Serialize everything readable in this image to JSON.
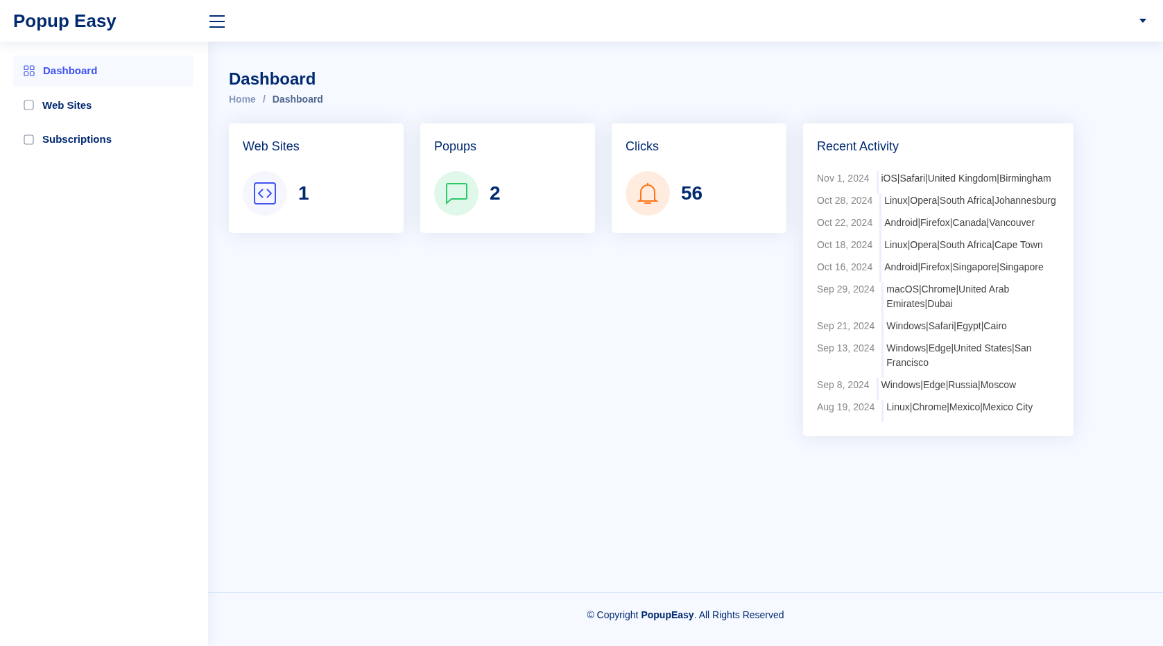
{
  "header": {
    "logo": "Popup Easy"
  },
  "sidebar": {
    "items": [
      {
        "label": "Dashboard",
        "kind": "grid",
        "selected": true
      },
      {
        "label": "Web Sites",
        "kind": "square",
        "selected": false
      },
      {
        "label": "Subscriptions",
        "kind": "square",
        "selected": false
      }
    ]
  },
  "page": {
    "title": "Dashboard",
    "breadcrumb_separator": "/",
    "breadcrumb": [
      {
        "label": "Home",
        "current": false
      },
      {
        "label": "Dashboard",
        "current": true
      }
    ]
  },
  "stats": [
    {
      "title": "Web Sites",
      "value": "1",
      "kind": "code",
      "color": "#4154f1"
    },
    {
      "title": "Popups",
      "value": "2",
      "kind": "chat",
      "color": "#2eca6a"
    },
    {
      "title": "Clicks",
      "value": "56",
      "kind": "bell",
      "color": "#ff771d"
    }
  ],
  "recent_activity": {
    "title": "Recent Activity",
    "items": [
      {
        "date": "Nov 1, 2024",
        "text": "iOS|Safari|United Kingdom|Birmingham"
      },
      {
        "date": "Oct 28, 2024",
        "text": "Linux|Opera|South Africa|Johannesburg"
      },
      {
        "date": "Oct 22, 2024",
        "text": "Android|Firefox|Canada|Vancouver"
      },
      {
        "date": "Oct 18, 2024",
        "text": "Linux|Opera|South Africa|Cape Town"
      },
      {
        "date": "Oct 16, 2024",
        "text": "Android|Firefox|Singapore|Singapore"
      },
      {
        "date": "Sep 29, 2024",
        "text": "macOS|Chrome|United Arab Emirates|Dubai"
      },
      {
        "date": "Sep 21, 2024",
        "text": "Windows|Safari|Egypt|Cairo"
      },
      {
        "date": "Sep 13, 2024",
        "text": "Windows|Edge|United States|San Francisco"
      },
      {
        "date": "Sep 8, 2024",
        "text": "Windows|Edge|Russia|Moscow"
      },
      {
        "date": "Aug 19, 2024",
        "text": "Linux|Chrome|Mexico|Mexico City"
      }
    ]
  },
  "footer": {
    "text": "© Copyright **PopupEasy**. All Rights Reserved"
  }
}
